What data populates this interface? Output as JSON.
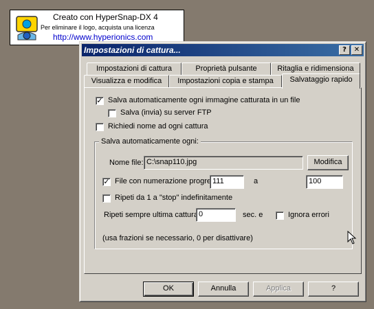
{
  "banner": {
    "line1": "Creato con HyperSnap-DX 4",
    "line2": "Per eliminare il logo, acquista una licenza",
    "url": "http://www.hyperionics.com"
  },
  "window": {
    "title": "Impostazioni di cattura...",
    "help_btn": "?",
    "close_btn": "✕"
  },
  "tabs": {
    "row1": [
      "Impostazioni di cattura",
      "Proprietà pulsante",
      "Ritaglia e ridimensiona"
    ],
    "row2": [
      "Visualizza e modifica",
      "Impostazioni copia e stampa",
      "Salvataggio rapido"
    ]
  },
  "panel": {
    "auto_save": {
      "label": "Salva automaticamente ogni immagine catturata in un file",
      "checked": true,
      "mark": "✓"
    },
    "ftp": {
      "label": "Salva (invia) su server FTP",
      "checked": false
    },
    "ask_name": {
      "label": "Richiedi nome ad ogni cattura",
      "checked": false
    },
    "group": {
      "title": "Salva automaticamente ogni:",
      "filename_label": "Nome file:",
      "filename_value": "C:\\snap110.jpg",
      "modify_btn": "Modifica",
      "numbering": {
        "label": "File con numerazione progressiva da",
        "checked": true,
        "mark": "✓",
        "from": "111",
        "to_label": "a",
        "to": "100"
      },
      "repeat": {
        "label": "Ripeti da 1 a \"stop\" indefinitamente",
        "checked": false
      },
      "repeat_last_label": "Ripeti sempre ultima cattura",
      "repeat_last_value": "0",
      "sec_label": "sec. e",
      "ignore_errors": {
        "label": "Ignora errori",
        "checked": false
      },
      "note": "(usa frazioni se necessario, 0 per disattivare)"
    }
  },
  "buttons": {
    "ok": "OK",
    "cancel": "Annulla",
    "apply": "Applica",
    "help": "?"
  }
}
